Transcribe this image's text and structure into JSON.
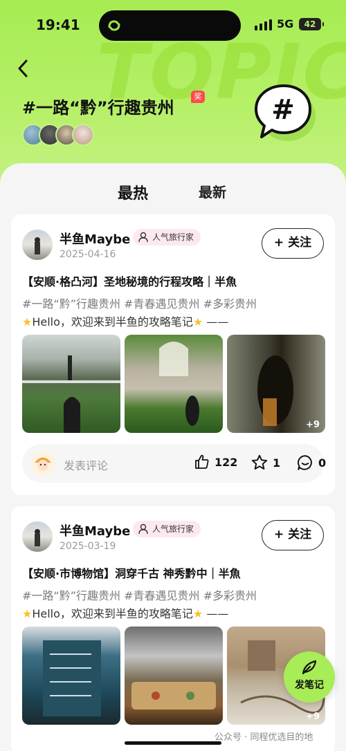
{
  "status_bar": {
    "time": "19:41",
    "network": "5G",
    "battery": "42"
  },
  "header": {
    "watermark": "TOPIC",
    "title": "#一路“黔”行趣贵州",
    "award_badge": "奖"
  },
  "tabs": [
    {
      "label": "最热",
      "active": true
    },
    {
      "label": "最新",
      "active": false
    }
  ],
  "posts": [
    {
      "user_name": "半鱼Maybe",
      "user_tag": "人气旅行家",
      "date": "2025-04-16",
      "follow_label": "+ 关注",
      "title": "【安顺·格凸河】圣地秘境的行程攻略｜半魚",
      "tags": "#一路“黔”行趣贵州 #青春遇见贵州 #多彩贵州",
      "intro_text": "Hello，欢迎来到半鱼的攻略笔记",
      "intro_suffix": " ——",
      "more_count": "+9",
      "comment_placeholder": "发表评论",
      "likes": "122",
      "favorites": "1",
      "comments": "0"
    },
    {
      "user_name": "半鱼Maybe",
      "user_tag": "人气旅行家",
      "date": "2025-03-19",
      "follow_label": "+ 关注",
      "title": "【安顺·市博物馆】洞穿千古 神秀黔中｜半魚",
      "tags": "#一路“黔”行趣贵州 #青春遇见贵州 #多彩贵州",
      "intro_text": "Hello，欢迎来到半鱼的攻略笔记",
      "intro_suffix": " ——",
      "more_count": "+9"
    }
  ],
  "fab": {
    "label": "发笔记"
  },
  "watermark_text": "公众号 · 同程优选目的地",
  "colors": {
    "accent": "#a8ec58",
    "tag_bg": "#fde8f1",
    "award": "#ff4b4b"
  }
}
